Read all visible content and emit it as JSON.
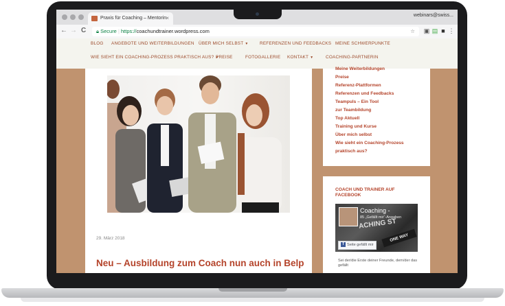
{
  "browser": {
    "tab_title": "Praxis für Coaching – Mentorin",
    "tab_close": "×",
    "account": "webinars@swiss...",
    "back": "←",
    "forward": "→",
    "reload": "C",
    "secure_label": "Secure",
    "url_protocol": "https://",
    "url_host": "coachundtrainer.wordpress.com",
    "star": "☆",
    "menu": "⋮"
  },
  "nav": {
    "row1": [
      "BLOG",
      "ANGEBOTE UND WEITERBILDUNGEN",
      "ÜBER MICH SELBST",
      "REFERENZEN UND FEEDBACKS",
      "MEINE SCHWERPUNKTE"
    ],
    "row2": [
      "WIE SIEHT EIN COACHING-PROZESS PRAKTISCH AUS?",
      "PREISE",
      "FOTOGALLERIE",
      "KONTAKT",
      "COACHING-PARTNERIN"
    ]
  },
  "post": {
    "date": "29. März 2018",
    "title": "Neu – Ausbildung zum Coach nun auch in Belp"
  },
  "sidebar": {
    "links": [
      "Meine Weiterbildungen",
      "Preise",
      "Referenz-Plattformen",
      "Referenzen und Feedbacks",
      "Teampuls – Ein Tool",
      "zur Teambildung",
      "Top Aktuell",
      "Training und Kurse",
      "Über mich selbst",
      "Wie sieht ein Coaching-Prozess",
      "praktisch aus?"
    ],
    "fb_heading": "COACH UND TRAINER AUF FACEBOOK",
    "fb_page_name": "Coaching -",
    "fb_likes": "85 „Gefällt mir“-Angaben",
    "fb_street": "ACHING ST",
    "fb_sign": "ONE WAY",
    "fb_like_button": "Seite gefällt mir",
    "fb_friends_text": "Sei der/die Erste deiner Freunde, dem/der das gefällt"
  },
  "colors": {
    "accent": "#b4432a",
    "page_bg": "#c0936f",
    "nav_bg": "#f4f4ee"
  }
}
